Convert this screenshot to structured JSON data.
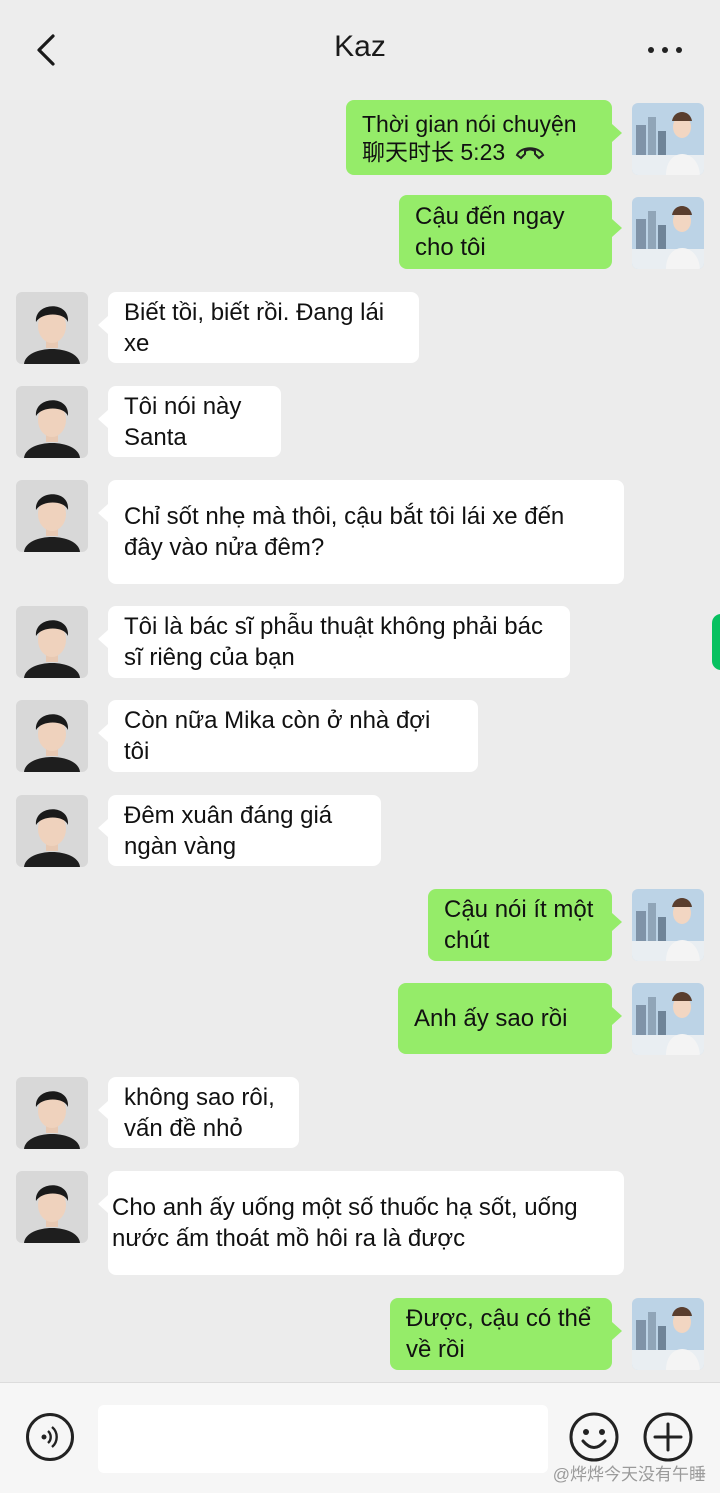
{
  "header": {
    "title": "Kaz"
  },
  "icons": {
    "back": "chevron-left-icon",
    "more": "more-dots-icon",
    "voice": "voice-icon",
    "emoji": "emoji-icon",
    "plus": "plus-icon",
    "call": "hangup-phone-icon"
  },
  "colors": {
    "sent_bubble": "#95ec69",
    "received_bubble": "#ffffff",
    "background": "#ececec"
  },
  "messages": [
    {
      "side": "right",
      "line1": "Thời gian nói chuyện",
      "line2": "聊天时长 5:23"
    },
    {
      "side": "right",
      "text": "Cậu đến ngay cho tôi"
    },
    {
      "side": "left",
      "text": "Biết tồi, biết rồi. Đang lái xe"
    },
    {
      "side": "left",
      "text": "Tôi nói này Santa"
    },
    {
      "side": "left",
      "text": "Chỉ sốt nhẹ mà thôi, cậu bắt tôi lái xe đến đây vào nửa đêm?"
    },
    {
      "side": "left",
      "text": "Tôi là bác sĩ phẫu thuật không phải bác sĩ riêng của bạn"
    },
    {
      "side": "left",
      "text": "Còn nữa Mika còn ở nhà đợi tôi"
    },
    {
      "side": "left",
      "text": "Đêm xuân đáng giá ngàn vàng"
    },
    {
      "side": "right",
      "text": "Cậu nói ít một chút"
    },
    {
      "side": "right",
      "text": "Anh ấy sao rồi"
    },
    {
      "side": "left",
      "text": "không sao rôi, vấn đề nhỏ"
    },
    {
      "side": "left",
      "text": "Cho anh ấy uống một số thuốc hạ sốt, uống nước ấm thoát mồ hôi ra là được"
    },
    {
      "side": "right",
      "text": "Được, cậu có thể về rồi"
    }
  ],
  "input": {
    "value": ""
  },
  "watermark": "@烨烨今天没有午睡"
}
